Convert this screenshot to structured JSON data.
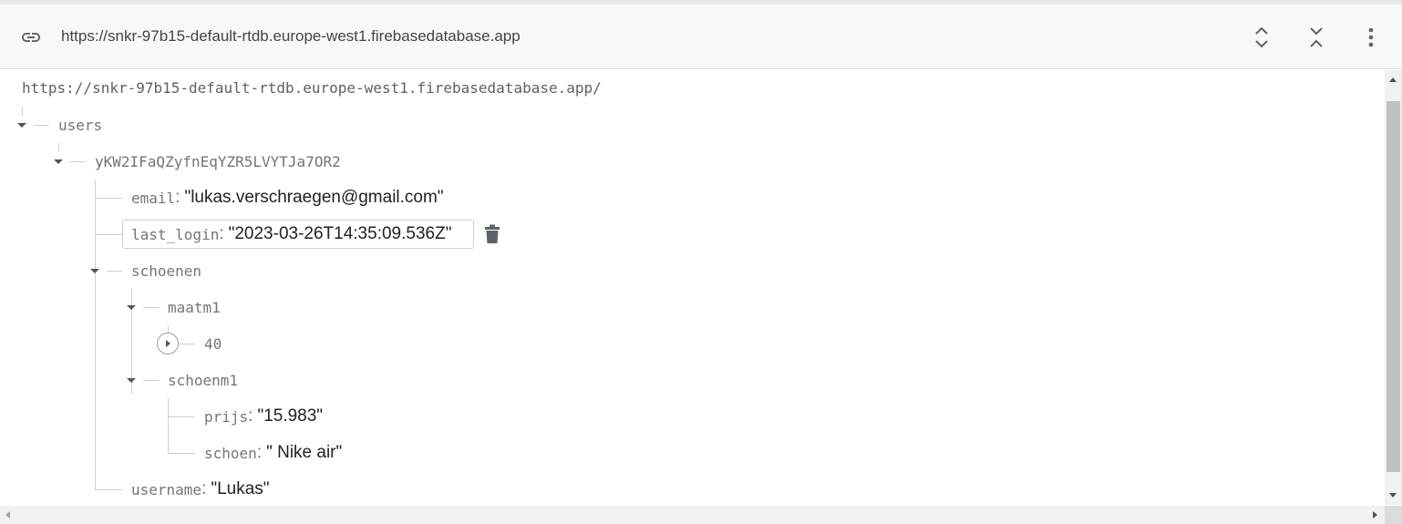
{
  "toolbar": {
    "url": "https://snkr-97b15-default-rtdb.europe-west1.firebasedatabase.app",
    "icons": [
      "link-icon",
      "expand-all-icon",
      "collapse-all-icon",
      "more-vert-icon"
    ]
  },
  "tree": {
    "root_url": "https://snkr-97b15-default-rtdb.europe-west1.firebasedatabase.app/",
    "users_key": "users",
    "uid_key": "yKW2IFaQZyfnEqYZR5LVYTJa7OR2",
    "email": {
      "key": "email",
      "value": "\"lukas.verschraegen@gmail.com\""
    },
    "last_login": {
      "key": "last_login",
      "value": "\"2023-03-26T14:35:09.536Z\""
    },
    "schoenen_key": "schoenen",
    "maatm1_key": "maatm1",
    "maat_child_key": "40",
    "schoenm1_key": "schoenm1",
    "prijs": {
      "key": "prijs",
      "value": "\"15.983\""
    },
    "schoen": {
      "key": "schoen",
      "value": "\" Nike air\""
    },
    "username": {
      "key": "username",
      "value": "\"Lukas\""
    },
    "colon": ":"
  },
  "colors": {
    "tree_line": "#cfcfcf",
    "key_text": "#757575",
    "value_text": "#212121"
  }
}
